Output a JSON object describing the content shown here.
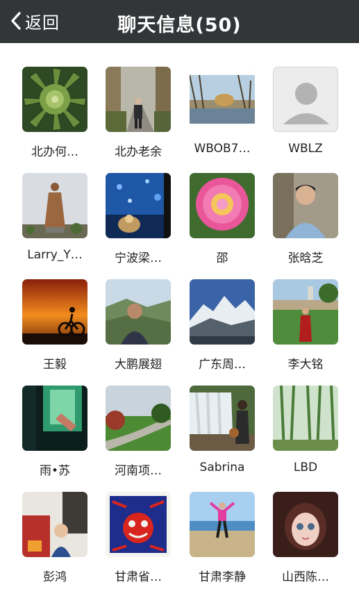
{
  "nav": {
    "back_label": "返回",
    "title": "聊天信息(50)",
    "background": "#323638"
  },
  "members": [
    {
      "name": "北办何…",
      "avatar": "succulent-plant"
    },
    {
      "name": "北办老余",
      "avatar": "man-on-tree-lined-road"
    },
    {
      "name": "WBOB7…",
      "avatar": "lakeside-trees"
    },
    {
      "name": "WBLZ",
      "avatar": "default-person-icon"
    },
    {
      "name": "Larry_Y…",
      "avatar": "bronze-statue"
    },
    {
      "name": "宁波梁…",
      "avatar": "night-bokeh"
    },
    {
      "name": "邵",
      "avatar": "pink-peony"
    },
    {
      "name": "张晗芝",
      "avatar": "man-portrait"
    },
    {
      "name": "王毅",
      "avatar": "cyclist-sunset-silhouette"
    },
    {
      "name": "大鹏展翅",
      "avatar": "man-at-great-wall"
    },
    {
      "name": "广东周…",
      "avatar": "snow-mountain"
    },
    {
      "name": "李大铭",
      "avatar": "graduate-on-lawn"
    },
    {
      "name": "雨•苏",
      "avatar": "hand-on-glass"
    },
    {
      "name": "河南项…",
      "avatar": "green-road-landscape"
    },
    {
      "name": "Sabrina",
      "avatar": "woman-at-waterfall"
    },
    {
      "name": "LBD",
      "avatar": "bamboo-forest"
    },
    {
      "name": "彭鸿",
      "avatar": "child-with-toys"
    },
    {
      "name": "甘肃省…",
      "avatar": "paper-cut-art"
    },
    {
      "name": "甘肃李静",
      "avatar": "woman-jumping-beach"
    },
    {
      "name": "山西陈…",
      "avatar": "child-in-hijab"
    }
  ]
}
